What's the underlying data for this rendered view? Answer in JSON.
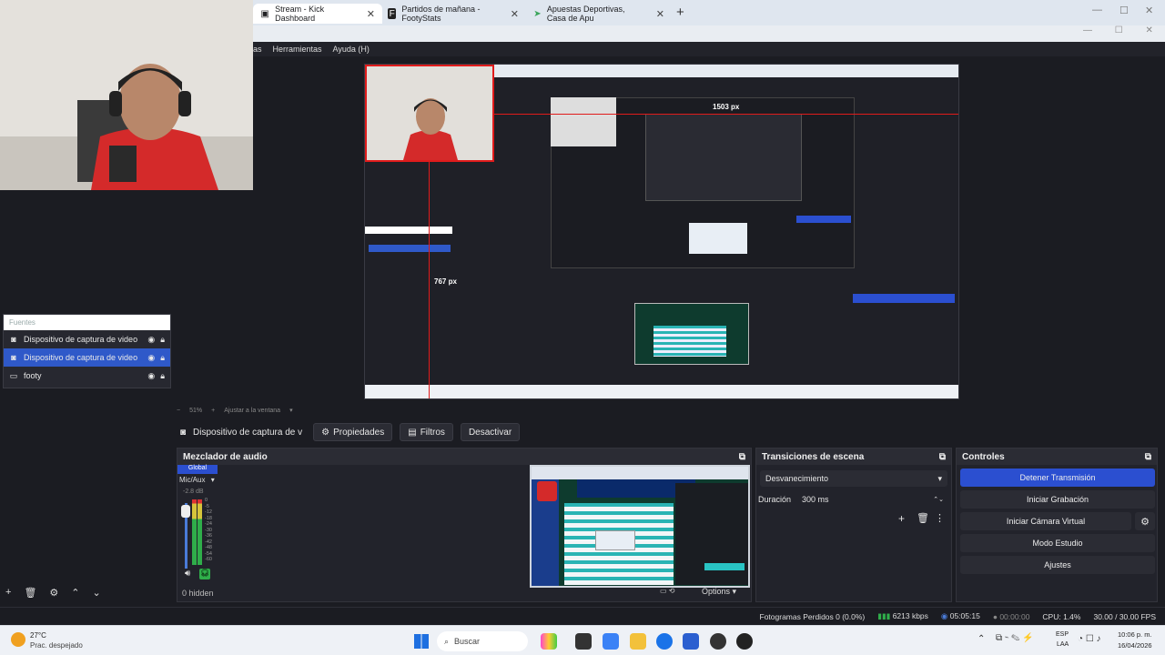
{
  "browser": {
    "tabs": [
      {
        "title": "Stream - Kick Dashboard",
        "active": true,
        "icon": "kick-icon"
      },
      {
        "title": "Partidos de mañana - FootyStats",
        "active": false,
        "icon": "footystats-icon"
      },
      {
        "title": "Apuestas Deportivas, Casa de Apu",
        "active": false,
        "icon": "betting-icon"
      }
    ],
    "new_tab": "+",
    "close_tab": "✕",
    "window_controls": {
      "minimize": "—",
      "maximize": "☐",
      "close": "✕"
    }
  },
  "obs": {
    "menu": [
      "as",
      "Herramientas",
      "Ayuda (H)"
    ],
    "preview": {
      "width_label": "1503 px",
      "height_label": "767 px"
    },
    "sources": {
      "title": "Fuentes",
      "items": [
        {
          "label": "Dispositivo de captura de video",
          "icon": "camera-icon",
          "selected": false
        },
        {
          "label": "Dispositivo de captura de video",
          "icon": "camera-icon",
          "selected": true
        },
        {
          "label": "footy",
          "icon": "monitor-icon",
          "selected": false
        }
      ]
    },
    "zoom": {
      "minus": "−",
      "value": "51%",
      "plus": "+",
      "fit": "Ajustar a la ventana"
    },
    "source_toolbar": {
      "source_name": "Dispositivo de captura de v",
      "properties": "Propiedades",
      "filters": "Filtros",
      "deactivate": "Desactivar"
    },
    "mixer": {
      "title": "Mezclador de audio",
      "global": "Global",
      "channel": "Mic/Aux",
      "level": "-2.8 dB",
      "scale": [
        "0",
        "-5",
        "-12",
        "-18",
        "-24",
        "-30",
        "-36",
        "-42",
        "-48",
        "-54",
        "-60"
      ],
      "hidden": "0 hidden",
      "options": "Options"
    },
    "transitions": {
      "title": "Transiciones de escena",
      "selected": "Desvanecimiento",
      "duration_label": "Duración",
      "duration_value": "300 ms"
    },
    "controls": {
      "title": "Controles",
      "buttons": [
        "Detener Transmisión",
        "Iniciar Grabación",
        "Iniciar Cámara Virtual",
        "Modo Estudio",
        "Ajustes"
      ]
    },
    "status": {
      "dropped": "Fotogramas Perdidos 0 (0.0%)",
      "bitrate": "6213 kbps",
      "stream_time": "05:05:15",
      "rec_time": "00:00:00",
      "cpu": "CPU: 1.4%",
      "fps": "30.00 / 30.00 FPS"
    }
  },
  "taskbar": {
    "weather_temp": "27°C",
    "weather_desc": "Prac. despejado",
    "search": "Buscar",
    "lang": "ESP",
    "lang2": "LAA",
    "time": "10:06 p. m.",
    "date": "16/04/2026"
  },
  "colors": {
    "accent": "#2b4fd0",
    "guide": "#e01b1b",
    "obs_bg": "#1b1c22"
  }
}
